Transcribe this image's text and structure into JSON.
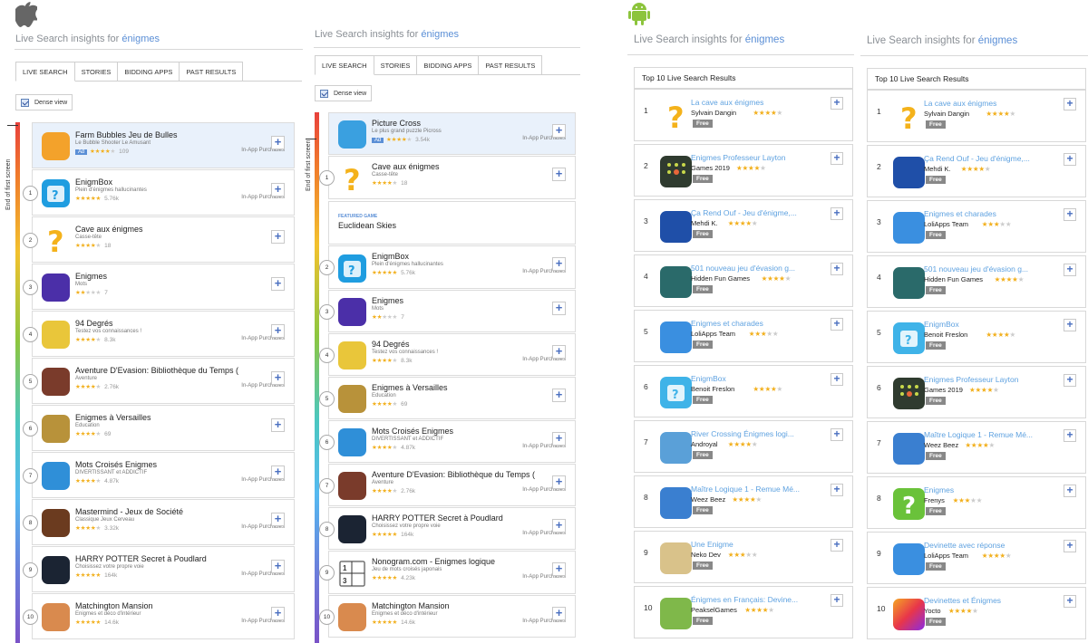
{
  "header": {
    "prefix": "Live Search insights for ",
    "query": "énigmes"
  },
  "ios_tabs": [
    "LIVE SEARCH",
    "STORIES",
    "BIDDING APPS",
    "PAST RESULTS"
  ],
  "dense_view": "Dense view",
  "end_label": "End of first screen",
  "ad_label": "Ad",
  "iap_label": "In-App Purchases",
  "featured": {
    "label": "FEATURED GAME",
    "title": "Euclidean Skies"
  },
  "ios1": [
    {
      "rank": "",
      "title": "Farm Bubbles Jeu de Bulles",
      "subtitle": "Le Bubble Shooter Le Amusant",
      "stars": 4,
      "count": "109",
      "iap": true,
      "ad": true,
      "icon": "farm-bubbles-icon",
      "color": "#f3a22b"
    },
    {
      "rank": "1",
      "title": "EnigmBox",
      "subtitle": "Plein d'énigmes hallucinantes",
      "stars": 5,
      "count": "5.76k",
      "iap": true,
      "icon": "enigmbox-icon",
      "color": "#1f9de0"
    },
    {
      "rank": "2",
      "title": "Cave aux énigmes",
      "subtitle": "Casse-tête",
      "stars": 4,
      "count": "18",
      "iap": false,
      "icon": "cave-question-icon",
      "color": "#ffffff"
    },
    {
      "rank": "3",
      "title": "Enigmes",
      "subtitle": "Mots",
      "stars": 2,
      "count": "7",
      "iap": false,
      "icon": "enigmes-purple-icon",
      "color": "#4b2fa8"
    },
    {
      "rank": "4",
      "title": "94 Degrés",
      "subtitle": "Testez vos connaissances !",
      "stars": 4,
      "count": "8.3k",
      "iap": true,
      "icon": "94-degres-icon",
      "color": "#e9c63a"
    },
    {
      "rank": "5",
      "title": "Aventure D'Evasion: Bibliothèque du Temps (",
      "subtitle": "Aventure",
      "stars": 4,
      "count": "2.76k",
      "iap": true,
      "icon": "aventure-evasion-icon",
      "color": "#7a3b2b"
    },
    {
      "rank": "6",
      "title": "Enigmes à Versailles",
      "subtitle": "Education",
      "stars": 4,
      "count": "69",
      "iap": false,
      "icon": "versailles-icon",
      "color": "#b8923a"
    },
    {
      "rank": "7",
      "title": "Mots Croisés Enigmes",
      "subtitle": "DIVERTISSANT et ADDICTIF",
      "stars": 4,
      "count": "4.87k",
      "iap": true,
      "icon": "mots-croises-icon",
      "color": "#2f8fd8"
    },
    {
      "rank": "8",
      "title": "Mastermind - Jeux de Société",
      "subtitle": "Classique Jeux Cerveau",
      "stars": 4,
      "count": "3.32k",
      "iap": true,
      "icon": "mastermind-icon",
      "color": "#6b3b1f"
    },
    {
      "rank": "9",
      "title": "HARRY POTTER Secret à Poudlard",
      "subtitle": "Choisissez votre propre voie",
      "stars": 5,
      "count": "164k",
      "iap": true,
      "icon": "harry-potter-icon",
      "color": "#1b2433"
    },
    {
      "rank": "10",
      "title": "Matchington Mansion",
      "subtitle": "Enigmes et déco d'intérieur",
      "stars": 5,
      "count": "14.6k",
      "iap": true,
      "icon": "matchington-icon",
      "color": "#d98a4e"
    }
  ],
  "ios2": [
    {
      "rank": "",
      "title": "Picture Cross",
      "subtitle": "Le plus grand puzzle Picross",
      "stars": 4,
      "count": "3.54k",
      "iap": true,
      "ad": true,
      "icon": "picture-cross-icon",
      "color": "#3aa0e0"
    },
    {
      "rank": "1",
      "title": "Cave aux énigmes",
      "subtitle": "Casse-tête",
      "stars": 4,
      "count": "18",
      "iap": false,
      "icon": "cave-question-icon",
      "color": "#ffffff"
    },
    {
      "rank": "2",
      "title": "EnigmBox",
      "subtitle": "Plein d'énigmes hallucinantes",
      "stars": 5,
      "count": "5.76k",
      "iap": true,
      "icon": "enigmbox-icon",
      "color": "#1f9de0"
    },
    {
      "rank": "3",
      "title": "Enigmes",
      "subtitle": "Mots",
      "stars": 2,
      "count": "7",
      "iap": false,
      "icon": "enigmes-purple-icon",
      "color": "#4b2fa8"
    },
    {
      "rank": "4",
      "title": "94 Degrés",
      "subtitle": "Testez vos connaissances !",
      "stars": 4,
      "count": "8.3k",
      "iap": true,
      "icon": "94-degres-icon",
      "color": "#e9c63a"
    },
    {
      "rank": "5",
      "title": "Enigmes à Versailles",
      "subtitle": "Education",
      "stars": 4,
      "count": "69",
      "iap": false,
      "icon": "versailles-icon",
      "color": "#b8923a"
    },
    {
      "rank": "6",
      "title": "Mots Croisés Enigmes",
      "subtitle": "DIVERTISSANT et ADDICTIF",
      "stars": 4,
      "count": "4.87k",
      "iap": true,
      "icon": "mots-croises-icon",
      "color": "#2f8fd8"
    },
    {
      "rank": "7",
      "title": "Aventure D'Evasion: Bibliothèque du Temps (",
      "subtitle": "Aventure",
      "stars": 4,
      "count": "2.76k",
      "iap": true,
      "icon": "aventure-evasion-icon",
      "color": "#7a3b2b"
    },
    {
      "rank": "8",
      "title": "HARRY POTTER Secret à Poudlard",
      "subtitle": "Choisissez votre propre voie",
      "stars": 5,
      "count": "164k",
      "iap": true,
      "icon": "harry-potter-icon",
      "color": "#1b2433"
    },
    {
      "rank": "9",
      "title": "Nonogram.com - Enigmes logique",
      "subtitle": "Jeu de mots croisés japonais",
      "stars": 5,
      "count": "4.23k",
      "iap": true,
      "icon": "nonogram-icon",
      "color": "#f4f4f4"
    },
    {
      "rank": "10",
      "title": "Matchington Mansion",
      "subtitle": "Enigmes et déco d'intérieur",
      "stars": 5,
      "count": "14.6k",
      "iap": true,
      "icon": "matchington-icon",
      "color": "#d98a4e"
    }
  ],
  "android_box_title": "Top 10 Live Search Results",
  "free_label": "Free",
  "android1": [
    {
      "rank": "1",
      "title": "La cave aux énigmes",
      "dev": "Sylvain Dangin",
      "stars": 4,
      "icon": "cave-question-icon",
      "color": "#ffffff"
    },
    {
      "rank": "2",
      "title": "Enigmes Professeur Layton",
      "dev": "Games 2019",
      "stars": 4,
      "icon": "layton-grid-icon",
      "color": "#2f3b2f"
    },
    {
      "rank": "3",
      "title": "Ça Rend Ouf - Jeu d'énigme,...",
      "dev": "Mehdi K.",
      "stars": 4,
      "icon": "rend-ouf-icon",
      "color": "#1f4fa8"
    },
    {
      "rank": "4",
      "title": "501 nouveau jeu d'évasion g...",
      "dev": "Hidden Fun Games",
      "stars": 4,
      "icon": "evasion-door-icon",
      "color": "#2a6a6a"
    },
    {
      "rank": "5",
      "title": "Enigmes et charades",
      "dev": "LoliApps Team",
      "stars": 3,
      "icon": "charades-icon",
      "color": "#3a8fe0"
    },
    {
      "rank": "6",
      "title": "EnigmBox",
      "dev": "Benoit Freslon",
      "stars": 4,
      "icon": "enigmbox-icon",
      "color": "#3fb3e8"
    },
    {
      "rank": "7",
      "title": "River Crossing Énigmes logi...",
      "dev": "Androyal",
      "stars": 4,
      "icon": "river-crossing-icon",
      "color": "#5aa0d8"
    },
    {
      "rank": "8",
      "title": "Maître Logique 1 - Remue Mé...",
      "dev": "Weez Beez",
      "stars": 4,
      "icon": "maitre-logique-icon",
      "color": "#3a7fd0"
    },
    {
      "rank": "9",
      "title": "Une Enigme",
      "dev": "Neko Dev",
      "stars": 3,
      "icon": "parchment-icon",
      "color": "#d9c28a"
    },
    {
      "rank": "10",
      "title": "Énigmes en Français: Devine...",
      "dev": "PeakselGames",
      "stars": 4,
      "icon": "devine-cartoon-icon",
      "color": "#7fb84a"
    }
  ],
  "android2": [
    {
      "rank": "1",
      "title": "La cave aux énigmes",
      "dev": "Sylvain Dangin",
      "stars": 4,
      "icon": "cave-question-icon",
      "color": "#ffffff"
    },
    {
      "rank": "2",
      "title": "Ça Rend Ouf - Jeu d'énigme,...",
      "dev": "Mehdi K.",
      "stars": 4,
      "icon": "rend-ouf-icon",
      "color": "#1f4fa8"
    },
    {
      "rank": "3",
      "title": "Enigmes et charades",
      "dev": "LoliApps Team",
      "stars": 3,
      "icon": "charades-icon",
      "color": "#3a8fe0"
    },
    {
      "rank": "4",
      "title": "501 nouveau jeu d'évasion g...",
      "dev": "Hidden Fun Games",
      "stars": 4,
      "icon": "evasion-door-icon",
      "color": "#2a6a6a"
    },
    {
      "rank": "5",
      "title": "EnigmBox",
      "dev": "Benoit Freslon",
      "stars": 4,
      "icon": "enigmbox-icon",
      "color": "#3fb3e8"
    },
    {
      "rank": "6",
      "title": "Enigmes Professeur Layton",
      "dev": "Games 2019",
      "stars": 4,
      "icon": "layton-grid-icon",
      "color": "#2f3b2f"
    },
    {
      "rank": "7",
      "title": "Maître Logique 1 - Remue Mé...",
      "dev": "Weez Beez",
      "stars": 4,
      "icon": "maitre-logique-icon",
      "color": "#3a7fd0"
    },
    {
      "rank": "8",
      "title": "Enigmes",
      "dev": "Frenys",
      "stars": 3,
      "icon": "green-question-icon",
      "color": "#6ac23a"
    },
    {
      "rank": "9",
      "title": "Devinette avec réponse",
      "dev": "LoliApps Team",
      "stars": 4,
      "icon": "devinettes-icon",
      "color": "#3a8fe0"
    },
    {
      "rank": "10",
      "title": "Devinettes et Énigmes",
      "dev": "Yocto",
      "stars": 4,
      "icon": "gradient-icon",
      "color": "#e8364a"
    }
  ],
  "colors": {
    "accent": "#5b8fd6",
    "link": "#5fa2e0",
    "star": "#f2b01e"
  }
}
